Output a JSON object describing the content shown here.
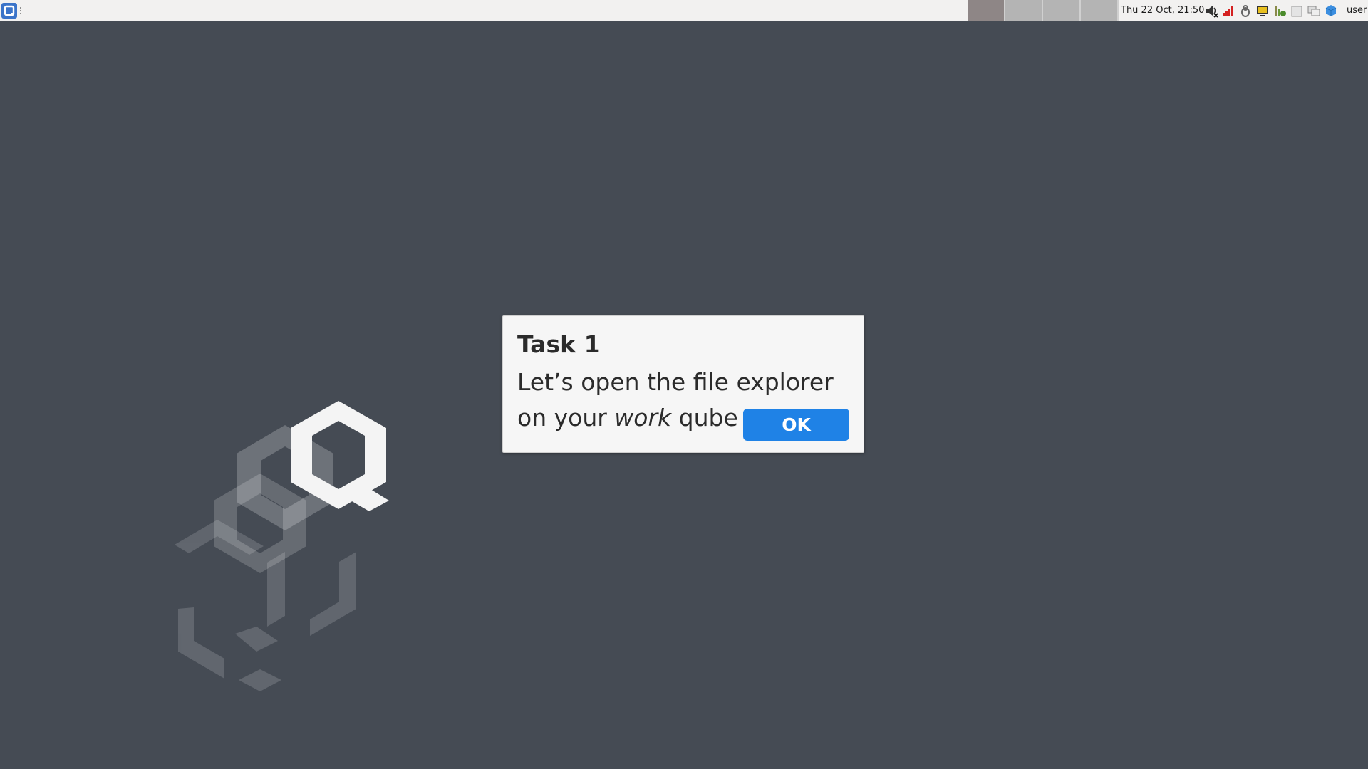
{
  "taskbar": {
    "menu_icon": "qubes-menu-icon",
    "workspaces": [
      {
        "name": "workspace-1",
        "active": true
      },
      {
        "name": "workspace-2",
        "active": false
      },
      {
        "name": "workspace-3",
        "active": false
      },
      {
        "name": "workspace-4",
        "active": false
      }
    ],
    "clock": "Thu 22 Oct, 21:50",
    "tray_icons": [
      "volume-muted-icon",
      "network-signal-icon",
      "updates-icon",
      "devices-icon",
      "domains-icon",
      "clipboard-icon",
      "windows-icon",
      "qube-icon"
    ],
    "user_label": "user"
  },
  "dialog": {
    "title": "Task 1",
    "body_before": "Let’s open the file explorer on your ",
    "body_em": "work",
    "body_after": " qube",
    "ok_label": "OK"
  },
  "colors": {
    "desktop": "#454b54",
    "ok_button": "#1f82e6"
  }
}
